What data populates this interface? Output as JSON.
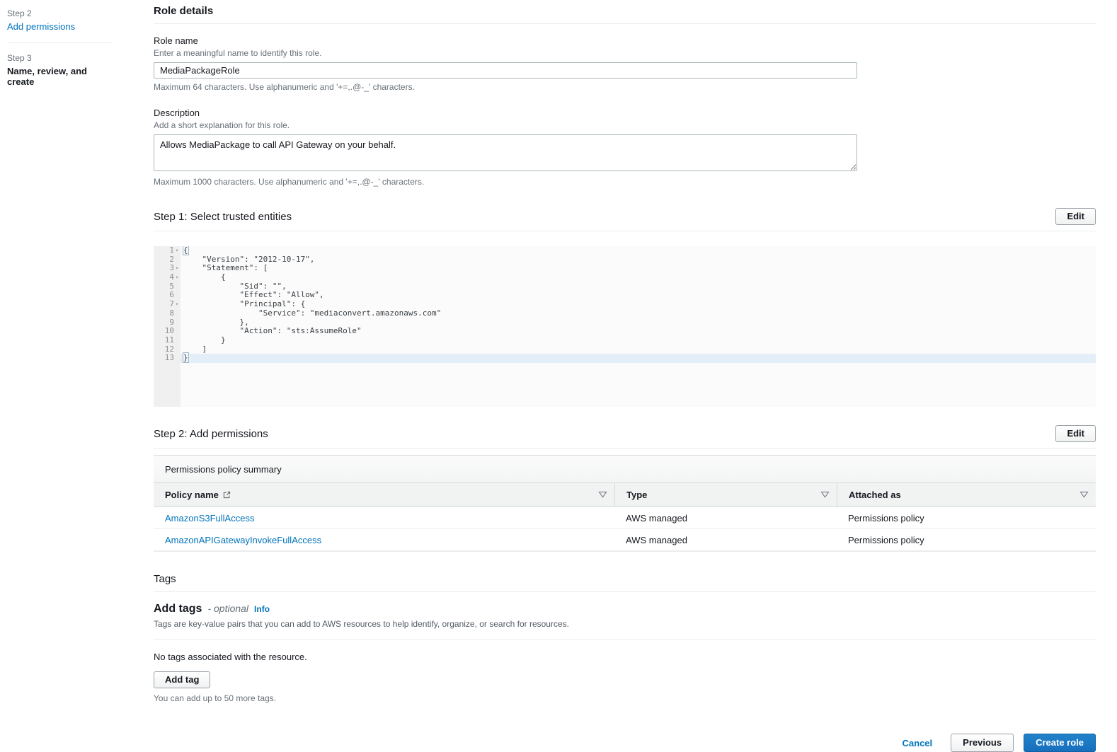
{
  "sidebar": {
    "steps": [
      {
        "step": "Step 2",
        "label": "Add permissions"
      },
      {
        "step": "Step 3",
        "label": "Name, review, and create"
      }
    ]
  },
  "role_details": {
    "title": "Role details",
    "role_name": {
      "label": "Role name",
      "help": "Enter a meaningful name to identify this role.",
      "value": "MediaPackageRole",
      "constraint": "Maximum 64 characters. Use alphanumeric and '+=,.@-_' characters."
    },
    "description": {
      "label": "Description",
      "help": "Add a short explanation for this role.",
      "value": "Allows MediaPackage to call API Gateway on your behalf.",
      "constraint": "Maximum 1000 characters. Use alphanumeric and '+=,.@-_' characters."
    }
  },
  "step1": {
    "title": "Step 1: Select trusted entities",
    "edit_label": "Edit",
    "code": {
      "lines": [
        {
          "num": "1",
          "fold": "▾",
          "text": "{"
        },
        {
          "num": "2",
          "fold": "",
          "text": "    \"Version\": \"2012-10-17\","
        },
        {
          "num": "3",
          "fold": "▾",
          "text": "    \"Statement\": ["
        },
        {
          "num": "4",
          "fold": "▾",
          "text": "        {"
        },
        {
          "num": "5",
          "fold": "",
          "text": "            \"Sid\": \"\","
        },
        {
          "num": "6",
          "fold": "",
          "text": "            \"Effect\": \"Allow\","
        },
        {
          "num": "7",
          "fold": "▾",
          "text": "            \"Principal\": {"
        },
        {
          "num": "8",
          "fold": "",
          "text": "                \"Service\": \"mediaconvert.amazonaws.com\""
        },
        {
          "num": "9",
          "fold": "",
          "text": "            },"
        },
        {
          "num": "10",
          "fold": "",
          "text": "            \"Action\": \"sts:AssumeRole\""
        },
        {
          "num": "11",
          "fold": "",
          "text": "        }"
        },
        {
          "num": "12",
          "fold": "",
          "text": "    ]"
        },
        {
          "num": "13",
          "fold": "",
          "text": "}"
        }
      ]
    }
  },
  "step2": {
    "title": "Step 2: Add permissions",
    "edit_label": "Edit",
    "panel_title": "Permissions policy summary",
    "table": {
      "headers": [
        "Policy name",
        "Type",
        "Attached as"
      ],
      "rows": [
        {
          "policy_name": "AmazonS3FullAccess",
          "type": "AWS managed",
          "attached_as": "Permissions policy"
        },
        {
          "policy_name": "AmazonAPIGatewayInvokeFullAccess",
          "type": "AWS managed",
          "attached_as": "Permissions policy"
        }
      ]
    }
  },
  "tags": {
    "section_title": "Tags",
    "title": "Add tags",
    "optional_label": "- optional",
    "info_label": "Info",
    "help": "Tags are key-value pairs that you can add to AWS resources to help identify, organize, or search for resources.",
    "empty_message": "No tags associated with the resource.",
    "add_button_label": "Add tag",
    "limit_message": "You can add up to 50 more tags."
  },
  "footer": {
    "cancel_label": "Cancel",
    "previous_label": "Previous",
    "create_label": "Create role"
  },
  "colors": {
    "link_blue": "#0073bb",
    "primary_button_blue": "#176fbd",
    "active_code_line": "#e4eef8"
  }
}
